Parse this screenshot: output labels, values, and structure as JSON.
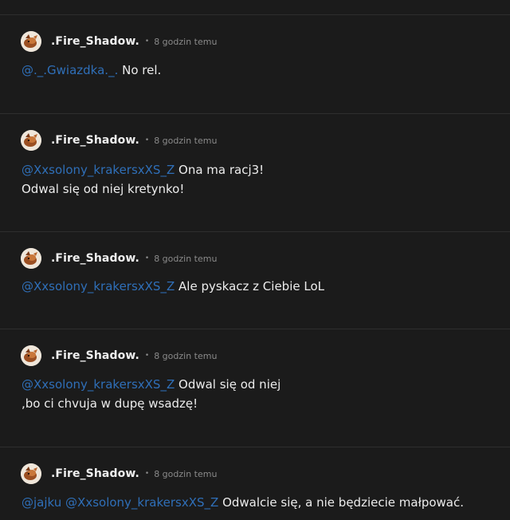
{
  "comments": [
    {
      "author": ".Fire_Shadow.",
      "separator": "•",
      "time": "8 godzin temu",
      "mentions": [
        "@._.Gwiazdka._."
      ],
      "lines": [
        "No rel."
      ]
    },
    {
      "author": ".Fire_Shadow.",
      "separator": "•",
      "time": "8 godzin temu",
      "mentions": [
        "@Xxsolony_krakersxXS_Z"
      ],
      "lines": [
        "Ona ma racj3!",
        "Odwal się od niej kretynko!"
      ]
    },
    {
      "author": ".Fire_Shadow.",
      "separator": "•",
      "time": "8 godzin temu",
      "mentions": [
        "@Xxsolony_krakersxXS_Z"
      ],
      "lines": [
        "Ale pyskacz z Ciebie LoL"
      ]
    },
    {
      "author": ".Fire_Shadow.",
      "separator": "•",
      "time": "8 godzin temu",
      "mentions": [
        "@Xxsolony_krakersxXS_Z"
      ],
      "lines": [
        "Odwal się od niej",
        ",bo ci chvuja w dupę wsadzę!"
      ]
    },
    {
      "author": ".Fire_Shadow.",
      "separator": "•",
      "time": "8 godzin temu",
      "mentions": [
        "@jajku",
        "@Xxsolony_krakersxXS_Z"
      ],
      "lines": [
        "Odwalcie się, a nie będziecie małpować."
      ]
    }
  ],
  "avatar_icon": "user-avatar-icon",
  "colors": {
    "background": "#1b1b1b",
    "text": "#ececec",
    "mention": "#2f6fb8",
    "meta": "#8a8a8a",
    "divider": "#2e2e2e"
  }
}
